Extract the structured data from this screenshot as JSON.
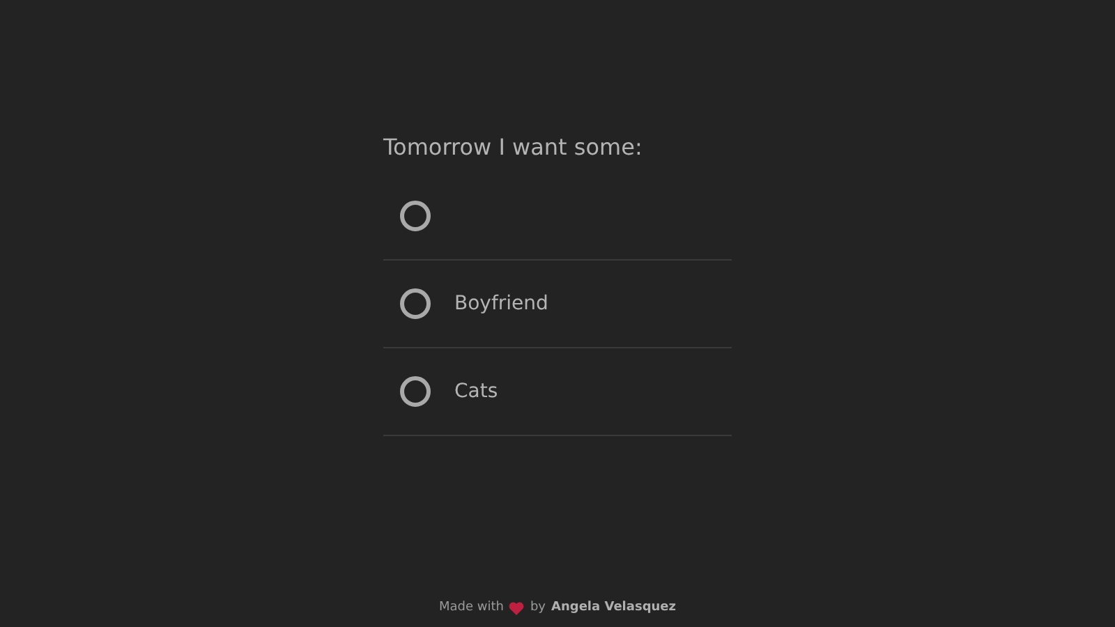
{
  "question": "Tomorrow I want some:",
  "options": [
    {
      "selected": false
    },
    {
      "label": "Boyfriend",
      "selected": false
    },
    {
      "label": "Cats",
      "selected": false
    }
  ],
  "footer": {
    "before": "Made with",
    "after": "by",
    "author": "Angela Velasquez"
  }
}
